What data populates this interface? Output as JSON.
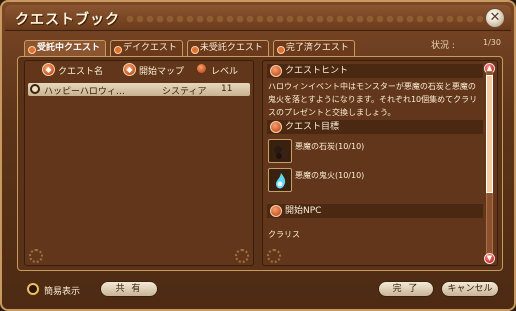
{
  "window": {
    "title": "クエストブック"
  },
  "tabs": [
    {
      "label": "受託中クエスト",
      "active": true
    },
    {
      "label": "デイクエスト",
      "active": false
    },
    {
      "label": "未受託クエスト",
      "active": false
    },
    {
      "label": "完了済クエスト",
      "active": false
    }
  ],
  "status": {
    "label": "状況 :",
    "value": "1/30"
  },
  "quest_list": {
    "headers": {
      "name": "クエスト名",
      "map": "開始マップ",
      "level": "レベル"
    },
    "rows": [
      {
        "name": "ハッピーハロウィ…",
        "map": "システィア",
        "level": "11"
      }
    ]
  },
  "details": {
    "hint_header": "クエストヒント",
    "hint_text": "ハロウィンイベント中はモンスターが悪魔の石炭と悪魔の鬼火を落とすようになります。それぞれ10個集めてクラリスのプレゼントと交換しましょう。",
    "objective_header": "クエスト目標",
    "objectives": [
      {
        "label": "悪魔の石炭(10/10)",
        "icon": "coal-icon"
      },
      {
        "label": "悪魔の鬼火(10/10)",
        "icon": "wisp-icon"
      }
    ],
    "npc_header": "開始NPC",
    "npc_name": "クラリス"
  },
  "footer": {
    "simple_view": "簡易表示",
    "share": "共 有",
    "complete": "完 了",
    "cancel": "キャンセル"
  },
  "colors": {
    "frame": "#5c3418",
    "accent": "#c89a60",
    "highlight": "#e8d8bc"
  }
}
